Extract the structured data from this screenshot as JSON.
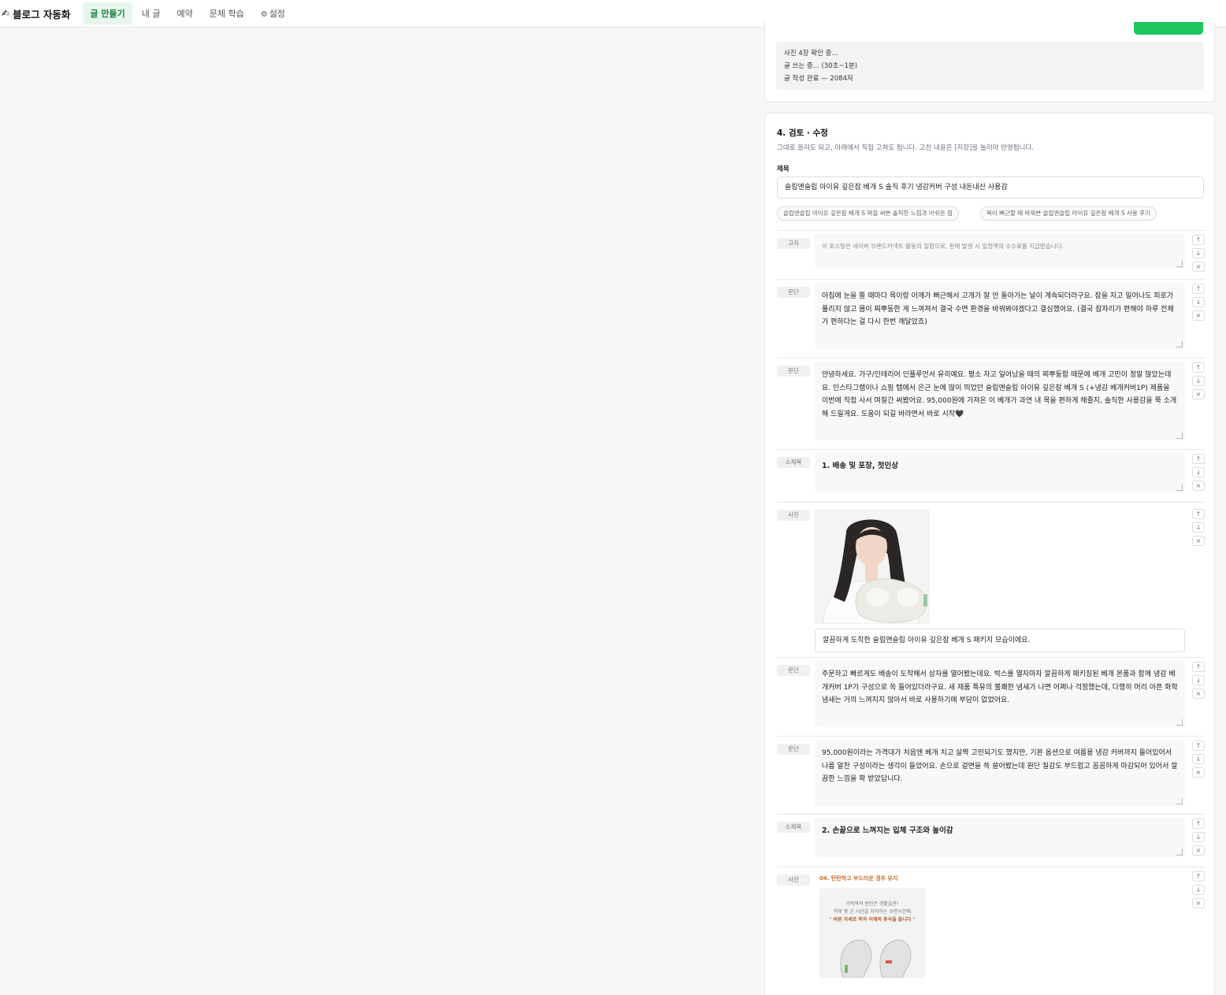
{
  "app": {
    "title": "블로그 자동화"
  },
  "nav": {
    "tabs": [
      {
        "label": "글 만들기",
        "active": true
      },
      {
        "label": "내 글"
      },
      {
        "label": "예약"
      },
      {
        "label": "문체 학습"
      },
      {
        "label": "설정"
      }
    ]
  },
  "progress": {
    "lines": [
      "사진 4장 확인 중...",
      "글 쓰는 중... (30초~1분)",
      "글 작성 완료 — 2084자"
    ]
  },
  "review": {
    "title": "4. 검토 · 수정",
    "desc": "그대로 올려도 되고, 아래에서 직접 고쳐도 됩니다. 고친 내용은 [저장]을 눌러야 반영됩니다.",
    "title_label": "제목",
    "title_value": "슬립앤슬립 아이유 깊은잠 베개 S 솔직 후기 냉감커버 구성 내돈내산 사용감",
    "chips": [
      "슬립앤슬립 아이유 깊은잠 베개 S 며칠 써본 솔직한 느낌과 아쉬운 점",
      "목이 뻐근할 때 바꿔본 슬립앤슬립 아이유 깊은잠 베개 S 사용 후기"
    ]
  },
  "controls": {
    "up": "↑",
    "down": "↓",
    "remove": "×"
  },
  "blocks": [
    {
      "tag": "고지",
      "text": "이 포스팅은 네이버 브랜드커넥트 활동의 일환으로, 판매 발생 시 일정액의 수수료를 지급받습니다."
    },
    {
      "tag": "문단",
      "text": "아침에 눈을 뜰 때마다 목이랑 어깨가 뻐근해서 고개가 잘 안 돌아가는 날이 계속되더라구요. 잠을 자고 일어나도 피로가 풀리지 않고 몸이 찌뿌둥한 게 느껴져서 결국 수면 환경을 바꿔봐야겠다고 결심했어요. (결국 잠자리가 편해야 하루 전체가 편하다는 걸 다시 한번 깨달았죠)"
    },
    {
      "tag": "문단",
      "text": "안녕하세요. 가구/인테리어 인플루언서 유히예요. 평소 자고 일어났을 때의 찌뿌둥함 때문에 베개 고민이 정말 많았는데요. 인스타그램이나 쇼핑 탭에서 은근 눈에 많이 띄었던 슬립앤슬립 아이유 깊은잠 베개 S (+냉감 베개커버1P) 제품을 이번에 직접 사서 며칠간 써봤어요. 95,000원에 가져온 이 베개가 과연 내 목을 편하게 해줄지, 솔직한 사용감을 쭉 소개해 드릴게요. 도움이 되길 바라면서 바로 시작🖤"
    },
    {
      "tag": "소제목",
      "text": "1. 배송 및 포장, 첫인상"
    },
    {
      "tag": "사진",
      "caption": "깔끔하게 도착한 슬립앤슬립 아이유 깊은잠 베개 S 패키지 모습이에요."
    },
    {
      "tag": "문단",
      "text": "주문하고 빠르게도 배송이 도착해서 상자를 열어봤는데요. 박스를 열자마자 깔끔하게 패키징된 베개 본품과 함께 냉감 베개커버 1P가 구성으로 쏙 들어있더라구요. 새 제품 특유의 불쾌한 냄새가 나면 어쩌나 걱정했는데, 다행히 머리 아픈 화학 냄새는 거의 느껴지지 않아서 바로 사용하기에 부담이 없었어요."
    },
    {
      "tag": "문단",
      "text": "95,000원이라는 가격대가 처음엔 베개 치고 살짝 고민되기도 했지만, 기본 옵션으로 여름용 냉감 커버까지 들어있어서 나름 알찬 구성이라는 생각이 들었어요. 손으로 겉면을 쓱 쓸어봤는데 원단 질감도 부드럽고 꼼꼼하게 마감되어 있어서 깔끔한 느낌을 확 받았답니다."
    },
    {
      "tag": "소제목",
      "text": "2. 손끝으로 느껴지는 입체 구조와 높이감"
    },
    {
      "tag": "사진",
      "image_title": "04. 탄탄하고 부드러운 경추 유지",
      "image_lines": [
        "거북목의 원인은 생활습관!",
        "하루 중 긴 시간을 차지하는 수면시간에",
        "\" 바른 자세로 목과 어깨의 휴식을 줍니다 \""
      ]
    }
  ]
}
